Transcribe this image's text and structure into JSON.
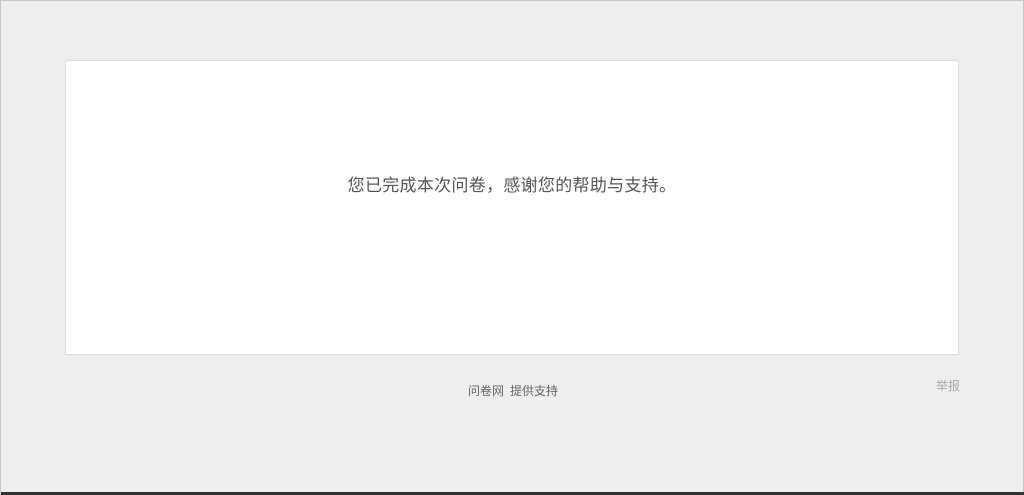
{
  "card": {
    "message": "您已完成本次问卷，感谢您的帮助与支持。"
  },
  "footer": {
    "brand_link": "问卷网",
    "support_text": "提供支持",
    "report_link": "举报"
  },
  "colors": {
    "page_background": "#eeeeee",
    "card_background": "#ffffff",
    "message_text": "#555555",
    "report_text": "#aaaaaa"
  }
}
